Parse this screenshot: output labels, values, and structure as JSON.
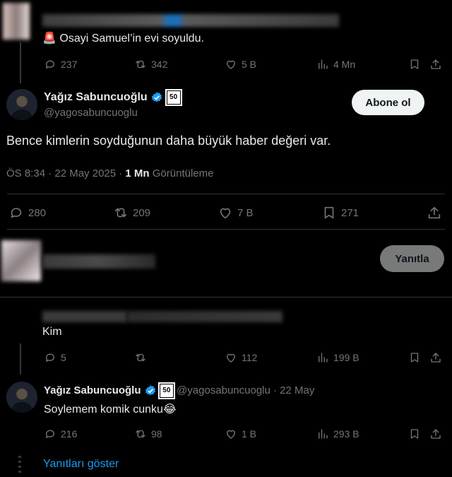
{
  "top_reply": {
    "emoji": "🚨",
    "text": "Osayi Samuel’in evi soyuldu.",
    "stats": {
      "replies": "237",
      "reposts": "342",
      "likes": "5 B",
      "views": "4 Mn"
    }
  },
  "main_tweet": {
    "display_name": "Yağız Sabuncuoğlu",
    "handle": "@yagosabuncuoglu",
    "badge_text": "50",
    "follow_label": "Abone ol",
    "text": "Bence kimlerin soyduğunun daha büyük haber değeri var.",
    "timestamp": "ÖS 8:34 · 22 May 2025 · ",
    "views_count": "1 Mn",
    "views_label": " Görüntüleme",
    "stats": {
      "replies": "280",
      "reposts": "209",
      "likes": "7 B",
      "bookmarks": "271"
    }
  },
  "reply_box": {
    "button_label": "Yanıtla"
  },
  "reply_1": {
    "text": "Kim",
    "stats": {
      "replies": "5",
      "reposts": "",
      "likes": "112",
      "views": "199 B"
    }
  },
  "reply_2": {
    "display_name": "Yağız Sabuncuoğlu",
    "badge_text": "50",
    "handle_date": "@yagosabuncuoglu · 22 May",
    "text": "Soylemem komik cunku😂",
    "stats": {
      "replies": "216",
      "reposts": "98",
      "likes": "1 B",
      "views": "293 B"
    }
  },
  "show_replies_label": "Yanıtları göster",
  "colors": {
    "background": "#000000",
    "text": "#e7e9ea",
    "muted": "#71767b",
    "link": "#1d9bf0",
    "divider": "#2f3336"
  }
}
